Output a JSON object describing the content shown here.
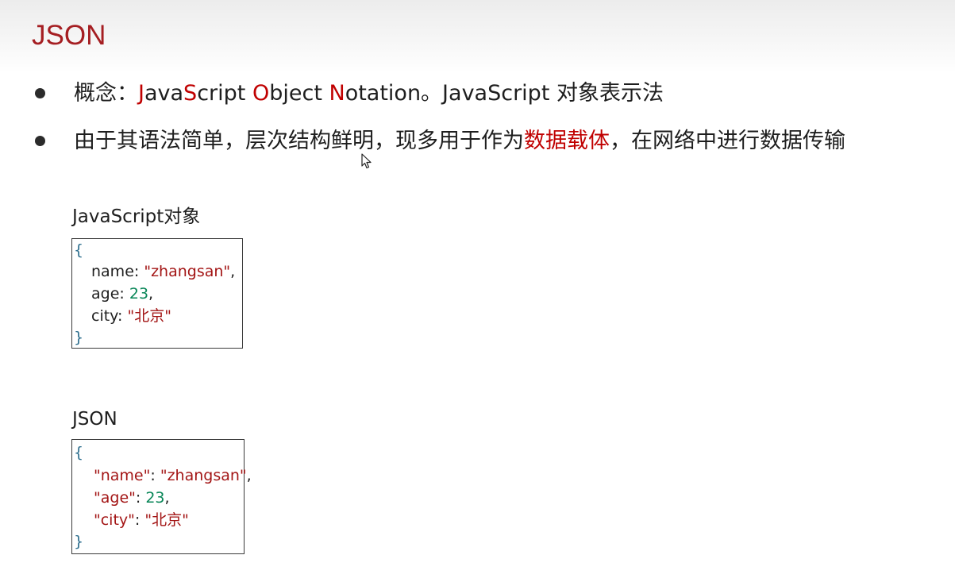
{
  "slide": {
    "title": "JSON"
  },
  "bullets": [
    {
      "prefix": "概念：",
      "j": "J",
      "ava": "ava",
      "s": "S",
      "cript": "cript ",
      "o": "O",
      "bject": "bject ",
      "n": "N",
      "otation": "otation。JavaScript 对象表示法"
    },
    {
      "before": "由于其语法简单，层次结构鲜明，现多用于作为",
      "highlight": "数据载体",
      "after": "，在网络中进行数据传输"
    }
  ],
  "js_object": {
    "label": "JavaScript对象",
    "open": "{",
    "close": "}",
    "lines": [
      {
        "key": "name",
        "sep": ": ",
        "value": "\"zhangsan\"",
        "trail": ","
      },
      {
        "key": "age",
        "sep": ": ",
        "value": "23",
        "trail": ","
      },
      {
        "key": "city",
        "sep": ": ",
        "value": "\"北京\"",
        "trail": ""
      }
    ]
  },
  "json_object": {
    "label": "JSON",
    "open": "{",
    "close": "}",
    "lines": [
      {
        "key": "\"name\"",
        "sep": ": ",
        "value": "\"zhangsan\"",
        "trail": ","
      },
      {
        "key": "\"age\"",
        "sep": ": ",
        "value": "23",
        "trail": ","
      },
      {
        "key": "\"city\"",
        "sep": ": ",
        "value": "\"北京\"",
        "trail": ""
      }
    ]
  },
  "colors": {
    "title": "#a51e22",
    "highlight": "#c00000",
    "string": "#a31515",
    "number": "#098658"
  },
  "icons": {
    "cursor": "mouse-pointer-icon",
    "bullet": "bullet-dot-icon"
  }
}
